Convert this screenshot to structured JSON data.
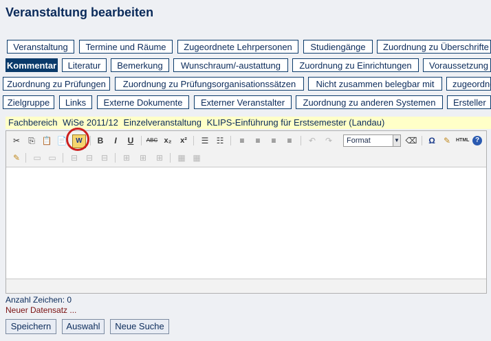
{
  "title": "Veranstaltung bearbeiten",
  "tabs": {
    "row1": [
      "Veranstaltung",
      "Termine und Räume",
      "Zugeordnete Lehrpersonen",
      "Studiengänge",
      "Zuordnung zu Überschrifte"
    ],
    "row2": [
      "Kommentar",
      "Literatur",
      "Bemerkung",
      "Wunschraum/-austattung",
      "Zuordnung zu Einrichtungen",
      "Voraussetzung"
    ],
    "row3": [
      "Zuordnung zu Prüfungen",
      "Zuordnung zu Prüfungsorganisationssätzen",
      "Nicht zusammen belegbar mit",
      "zugeordne"
    ],
    "row4": [
      "Zielgruppe",
      "Links",
      "Externe Dokumente",
      "Externer Veranstalter",
      "Zuordnung zu anderen Systemen",
      "Ersteller"
    ]
  },
  "infobar": {
    "fachbereich": "Fachbereich",
    "semester": "WiSe 2011/12",
    "type": "Einzelveranstaltung",
    "course": "KLIPS-Einführung für Erstsemester (Landau)"
  },
  "toolbar": {
    "format_label": "Format",
    "icons": {
      "cut": "✂",
      "copy": "⎘",
      "paste": "📋",
      "paste_text": "📄",
      "paste_word": "W",
      "bold": "B",
      "italic": "I",
      "underline": "U",
      "strike": "ABC",
      "sub": "x₂",
      "sup": "x²",
      "ul": "☰",
      "ol": "☷",
      "align_left": "≡",
      "align_center": "≡",
      "align_right": "≡",
      "justify": "≡",
      "undo": "↶",
      "redo": "↷",
      "eraser": "⌫",
      "omega": "Ω",
      "cleanup": "✎",
      "html": "HTML",
      "help": "?",
      "edit": "✎",
      "row1": "▭",
      "row2": "▭",
      "col1": "⊟",
      "col2": "⊟",
      "col3": "⊟",
      "merge1": "⊞",
      "merge2": "⊞",
      "merge3": "⊞",
      "table1": "▦",
      "table2": "▦"
    }
  },
  "status": {
    "chars": "Anzahl Zeichen: 0",
    "new_record": "Neuer Datensatz ..."
  },
  "buttons": {
    "save": "Speichern",
    "select": "Auswahl",
    "new_search": "Neue Suche"
  },
  "colors": {
    "accent": "#0a3a6a",
    "infobar_bg": "#ffffc8",
    "highlight_circle": "#cc1f1f"
  }
}
